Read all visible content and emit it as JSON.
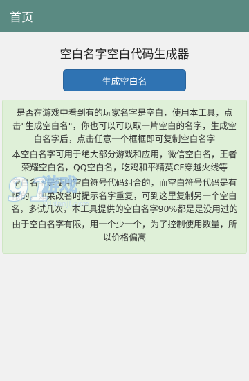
{
  "header": {
    "title": "首页"
  },
  "main": {
    "title": "空白名字空白代码生成器",
    "generate_button": "生成空白名",
    "paragraphs": [
      "是否在游戏中看到有的玩家名字是空白，使用本工具，点击\"生成空白名\"，你也可以可以取一片空白的名字，生成空白名字后，点击任意一个框框即可复制空白名字",
      "本空白名字可用于绝大部分游戏和应用，微信空白名，王者荣耀空白名，QQ空白名，吃鸡和平精英CF穿越火线等",
      "空白名字是使用空白符号代码组合的，而空白符号代码是有限的，如果改名时提示名字重复，可到这里复制另一个空白名，多试几次，本工具提供的空白名字90%都是是没用过的",
      "由于空白名字有限，用一个少一个，为了控制使用数量，所以价格偏高"
    ]
  },
  "watermark": {
    "number": "91",
    "text": "游戏",
    "url": "91danji.com"
  },
  "colors": {
    "header_bg": "#5a8a82",
    "button_bg": "#2f73b3",
    "info_bg": "#dff0d8"
  }
}
